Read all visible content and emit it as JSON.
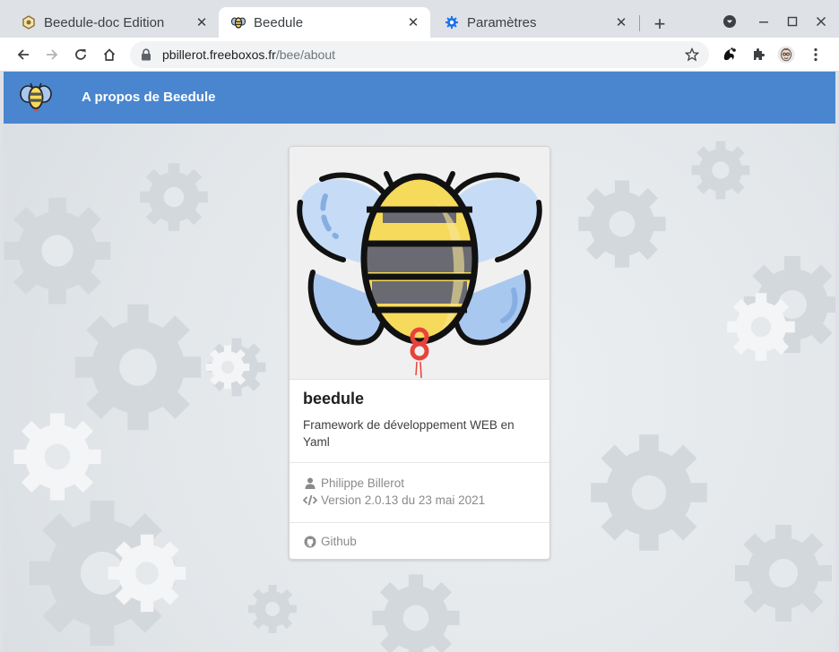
{
  "browser": {
    "tabs": [
      {
        "title": "Beedule-doc Edition",
        "close": "✕",
        "icon": "hexagon-doc-icon"
      },
      {
        "title": "Beedule",
        "close": "✕",
        "icon": "bee-icon"
      },
      {
        "title": "Paramètres",
        "close": "✕",
        "icon": "gear-icon"
      }
    ],
    "new_tab": "+",
    "url_host": "pbillerot.freeboxos.fr",
    "url_path": "/bee/about"
  },
  "app": {
    "title": "A propos de Beedule"
  },
  "card": {
    "name": "beedule",
    "description": "Framework de développement WEB en Yaml",
    "author": "Philippe Billerot",
    "version": "Version 2.0.13 du 23 mai 2021",
    "link": "Github"
  },
  "colors": {
    "appbar": "#4a86cf",
    "bee_yellow": "#f6da5b",
    "bee_stripe": "#6a6a72",
    "wing_blue": "#a9c8f0",
    "tag_red": "#e8423a"
  }
}
